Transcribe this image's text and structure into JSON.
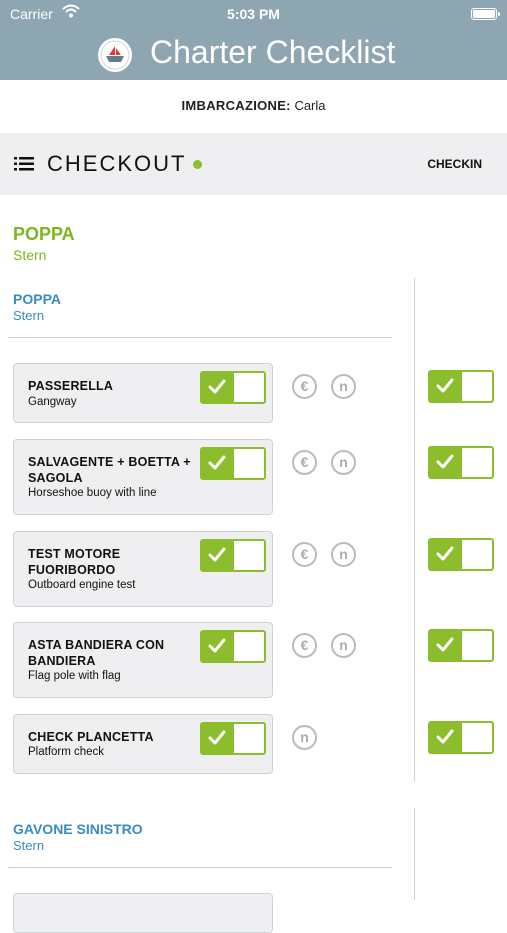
{
  "status_bar": {
    "carrier": "Carrier",
    "time": "5:03 PM"
  },
  "app": {
    "title": "Charter Checklist"
  },
  "boat": {
    "label": "IMBARCAZIONE:",
    "name": "Carla"
  },
  "tabs": {
    "active": "CHECKOUT",
    "inactive": "CHECKIN"
  },
  "section": {
    "title": "POPPA",
    "subtitle": "Stern"
  },
  "groups": [
    {
      "title": "POPPA",
      "subtitle": "Stern",
      "items": [
        {
          "label": "PASSERELLA",
          "sublabel": "Gangway",
          "checked": true,
          "icons": [
            "euro-icon",
            "n-icon"
          ],
          "checkin_checked": true
        },
        {
          "label": "SALVAGENTE + BOETTA + SAGOLA",
          "sublabel": "Horseshoe buoy with line",
          "checked": true,
          "icons": [
            "euro-icon",
            "n-icon"
          ],
          "checkin_checked": true
        },
        {
          "label": "TEST MOTORE FUORIBORDO",
          "sublabel": "Outboard engine test",
          "checked": true,
          "icons": [
            "euro-icon",
            "n-icon"
          ],
          "checkin_checked": true
        },
        {
          "label": "ASTA BANDIERA CON BANDIERA",
          "sublabel": "Flag pole with flag",
          "checked": true,
          "icons": [
            "euro-icon",
            "n-icon"
          ],
          "checkin_checked": true
        },
        {
          "label": "CHECK PLANCETTA",
          "sublabel": "Platform check",
          "checked": true,
          "icons": [
            "n-icon"
          ],
          "checkin_checked": true
        }
      ]
    },
    {
      "title": "GAVONE SINISTRO",
      "subtitle": "Stern",
      "items": []
    }
  ],
  "icon_glyphs": {
    "euro": "€",
    "n": "n"
  },
  "colors": {
    "header": "#8ea6b2",
    "accent_green": "#8cbd2c",
    "section_green": "#7fb51f",
    "group_blue": "#3a8ac6"
  }
}
